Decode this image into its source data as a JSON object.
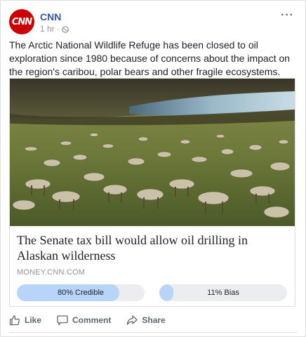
{
  "post": {
    "page_name": "CNN",
    "avatar_text": "CNN",
    "time": "1 hr",
    "separator": "·",
    "text": "The Arctic National Wildlife Refuge has been closed to oil exploration since 1980 because of concerns about the impact on the region's caribou, polar bears and other fragile ecosystems.",
    "more_label": "···"
  },
  "link": {
    "image_icon": "caribou-herd-photo",
    "title": "The Senate tax bill would allow oil drilling in Alaskan wilderness",
    "domain": "MONEY.CNN.COM"
  },
  "ratings": {
    "credible_label": "80% Credible",
    "credible_value": 80,
    "bias_label": "11% Bias",
    "bias_value": 11
  },
  "actions": {
    "like_label": "Like",
    "comment_label": "Comment",
    "share_label": "Share"
  },
  "colors": {
    "brand_red": "#cc0000",
    "page_link": "#365899",
    "pill_fill": "#b8d4f8",
    "pill_track": "#ebedf0"
  }
}
